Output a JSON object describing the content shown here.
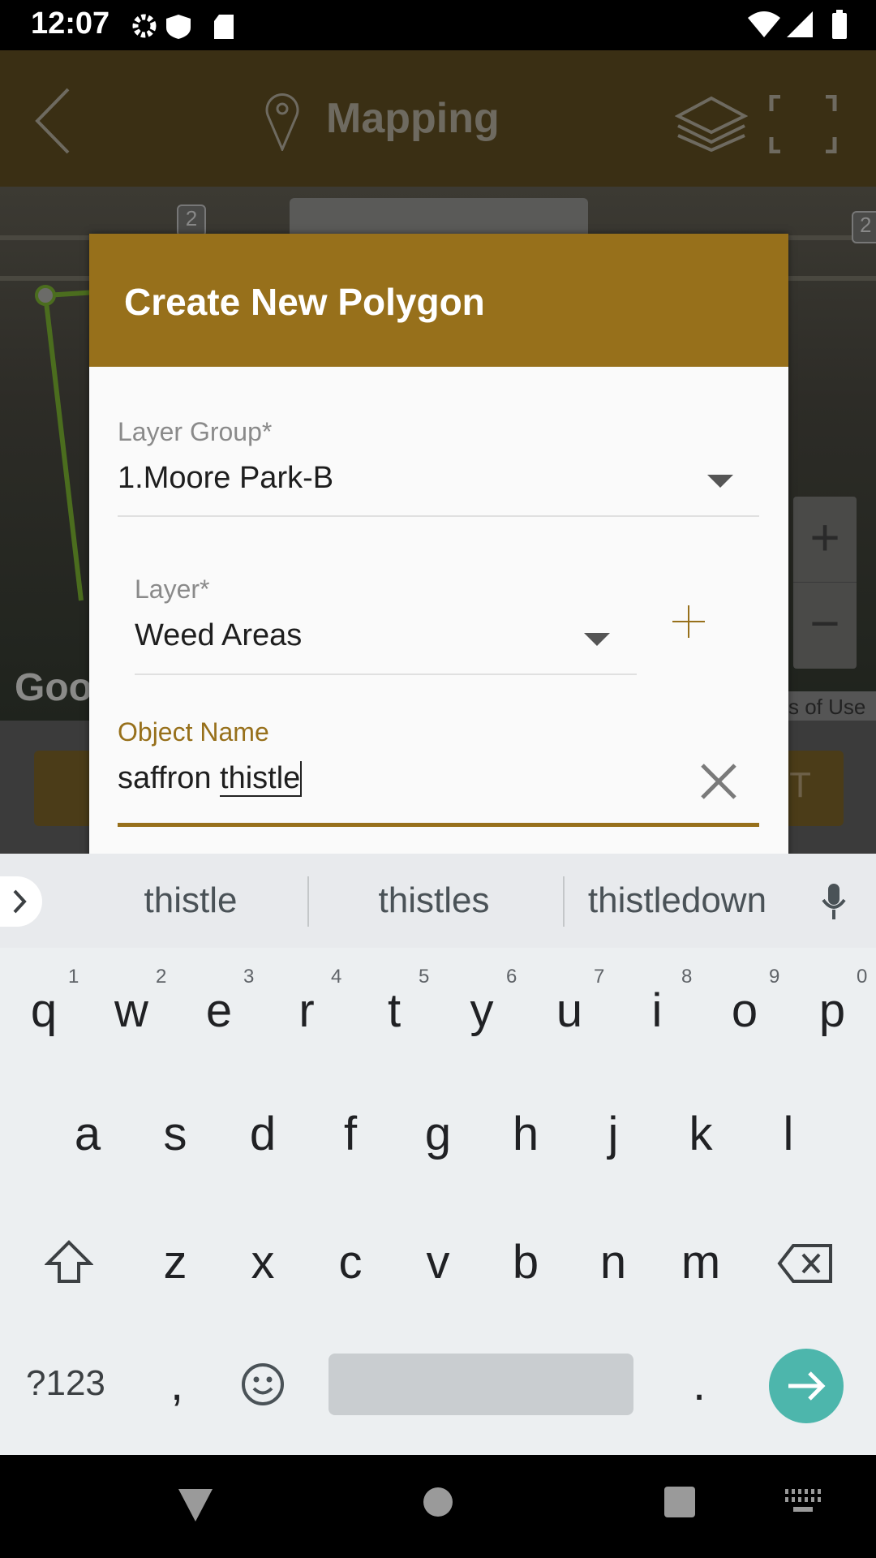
{
  "status_bar": {
    "time": "12:07",
    "icons": [
      "settings-icon",
      "shield-icon",
      "sd-card-icon",
      "wifi-icon",
      "signal-icon",
      "battery-icon"
    ]
  },
  "app_header": {
    "title": "Mapping",
    "icons": [
      "back-icon",
      "map-pin-icon",
      "layers-icon",
      "fullscreen-icon"
    ]
  },
  "map": {
    "badge_left": "2",
    "badge_right": "2",
    "google_logo": "Goo",
    "terms": "s of Use",
    "bottom_button_fragment": "T"
  },
  "dialog": {
    "title": "Create New Polygon",
    "layer_group": {
      "label": "Layer Group*",
      "value": "1.Moore Park-B"
    },
    "layer": {
      "label": "Layer*",
      "value": "Weed Areas"
    },
    "object_name": {
      "label": "Object Name",
      "value_prefix": "saffron ",
      "value_word": "thistle"
    },
    "accent_color": "#97701b"
  },
  "keyboard": {
    "suggestions": [
      "thistle",
      "thistles",
      "thistledown"
    ],
    "row1": [
      [
        "q",
        "1"
      ],
      [
        "w",
        "2"
      ],
      [
        "e",
        "3"
      ],
      [
        "r",
        "4"
      ],
      [
        "t",
        "5"
      ],
      [
        "y",
        "6"
      ],
      [
        "u",
        "7"
      ],
      [
        "i",
        "8"
      ],
      [
        "o",
        "9"
      ],
      [
        "p",
        "0"
      ]
    ],
    "row2": [
      "a",
      "s",
      "d",
      "f",
      "g",
      "h",
      "j",
      "k",
      "l"
    ],
    "row3": [
      "z",
      "x",
      "c",
      "v",
      "b",
      "n",
      "m"
    ],
    "symbols_key": "?123",
    "comma": ",",
    "period": ".",
    "enter_color": "#4db6ac"
  }
}
